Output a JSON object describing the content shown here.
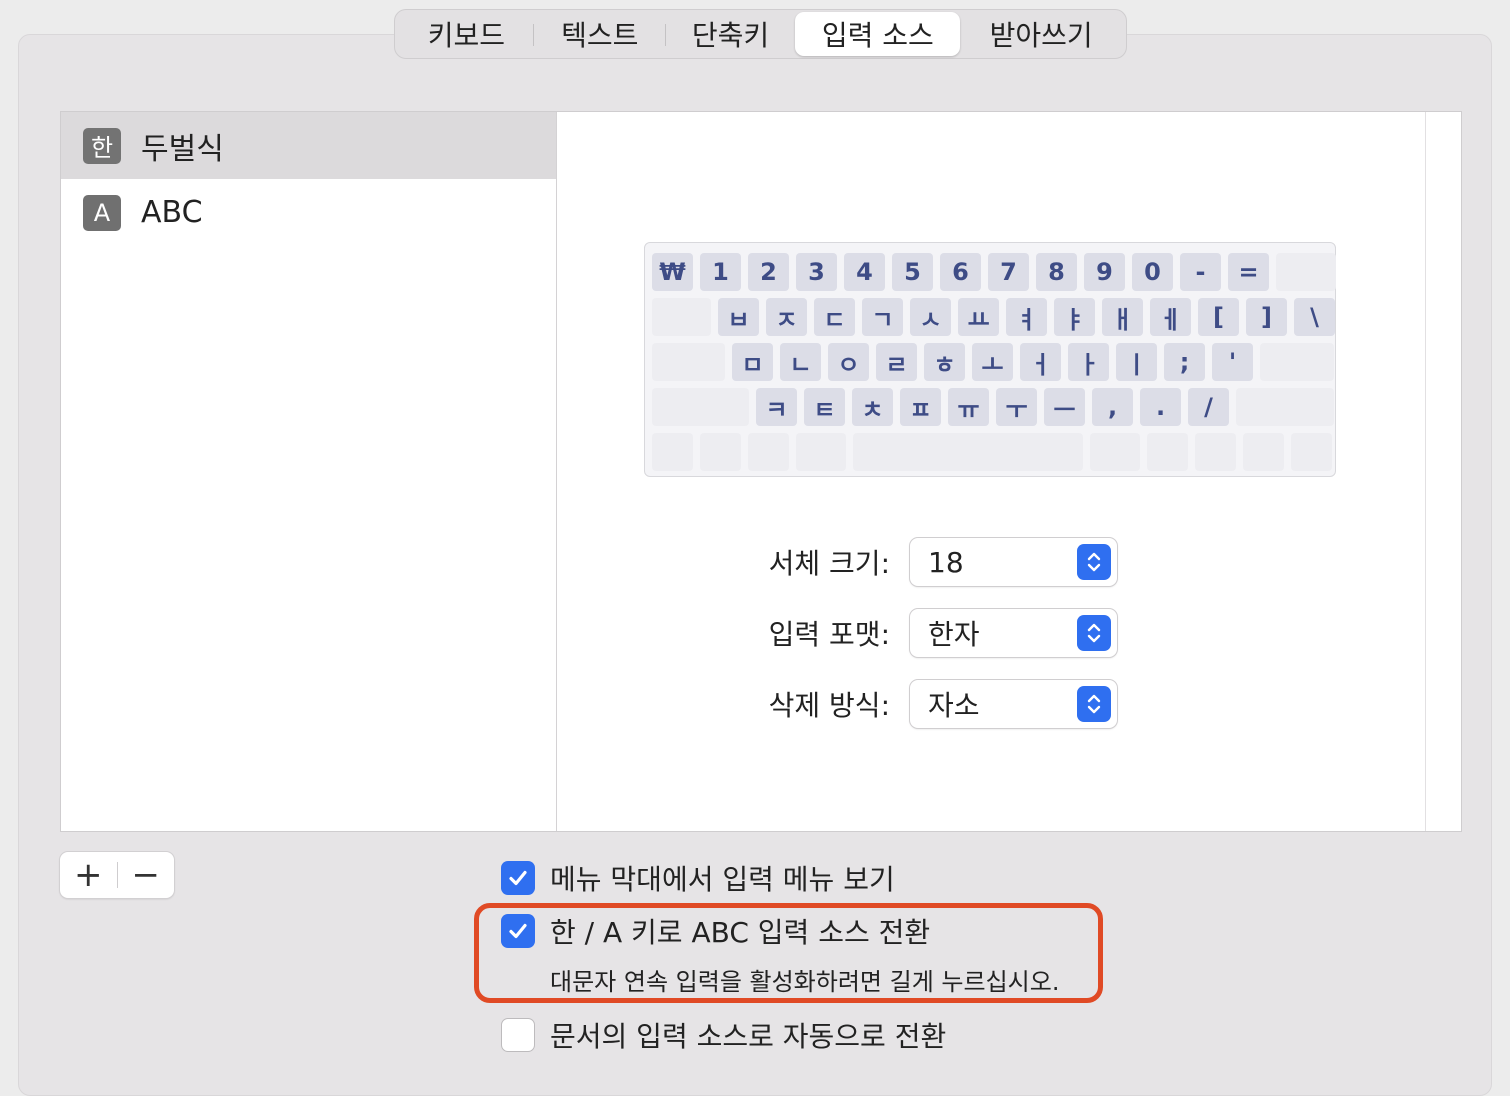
{
  "tabs": [
    {
      "label": "키보드",
      "active": false
    },
    {
      "label": "텍스트",
      "active": false
    },
    {
      "label": "단축키",
      "active": false
    },
    {
      "label": "입력 소스",
      "active": true
    },
    {
      "label": "받아쓰기",
      "active": false
    }
  ],
  "sources": [
    {
      "icon_text": "한",
      "label": "두벌식",
      "selected": true
    },
    {
      "icon_text": "A",
      "label": "ABC",
      "selected": false
    }
  ],
  "keyboard": {
    "row1": [
      "₩",
      "1",
      "2",
      "3",
      "4",
      "5",
      "6",
      "7",
      "8",
      "9",
      "0",
      "-",
      "="
    ],
    "row2": [
      "ㅂ",
      "ㅈ",
      "ㄷ",
      "ㄱ",
      "ㅅ",
      "ㅛ",
      "ㅕ",
      "ㅑ",
      "ㅐ",
      "ㅔ",
      "[",
      "]",
      "\\"
    ],
    "row3": [
      "ㅁ",
      "ㄴ",
      "ㅇ",
      "ㄹ",
      "ㅎ",
      "ㅗ",
      "ㅓ",
      "ㅏ",
      "ㅣ",
      ";",
      "'"
    ],
    "row4": [
      "ㅋ",
      "ㅌ",
      "ㅊ",
      "ㅍ",
      "ㅠ",
      "ㅜ",
      "ㅡ",
      ",",
      ".",
      "/"
    ]
  },
  "settings": {
    "font_size": {
      "label": "서체 크기:",
      "value": "18"
    },
    "input_format": {
      "label": "입력 포맷:",
      "value": "한자"
    },
    "delete_method": {
      "label": "삭제 방식:",
      "value": "자소"
    }
  },
  "buttons": {
    "add": "+",
    "remove": "−"
  },
  "options": {
    "show_menu": {
      "label": "메뉴 막대에서 입력 메뉴 보기",
      "checked": true
    },
    "han_key": {
      "label": "한 / A 키로 ABC 입력 소스 전환",
      "checked": true,
      "hint": "대문자 연속 입력을 활성화하려면 길게 누르십시오."
    },
    "auto_switch": {
      "label": "문서의 입력 소스로 자동으로 전환",
      "checked": false
    }
  },
  "colors": {
    "accent": "#2f6ff0",
    "highlight": "#e04a25",
    "key_text": "#3e4c86"
  }
}
